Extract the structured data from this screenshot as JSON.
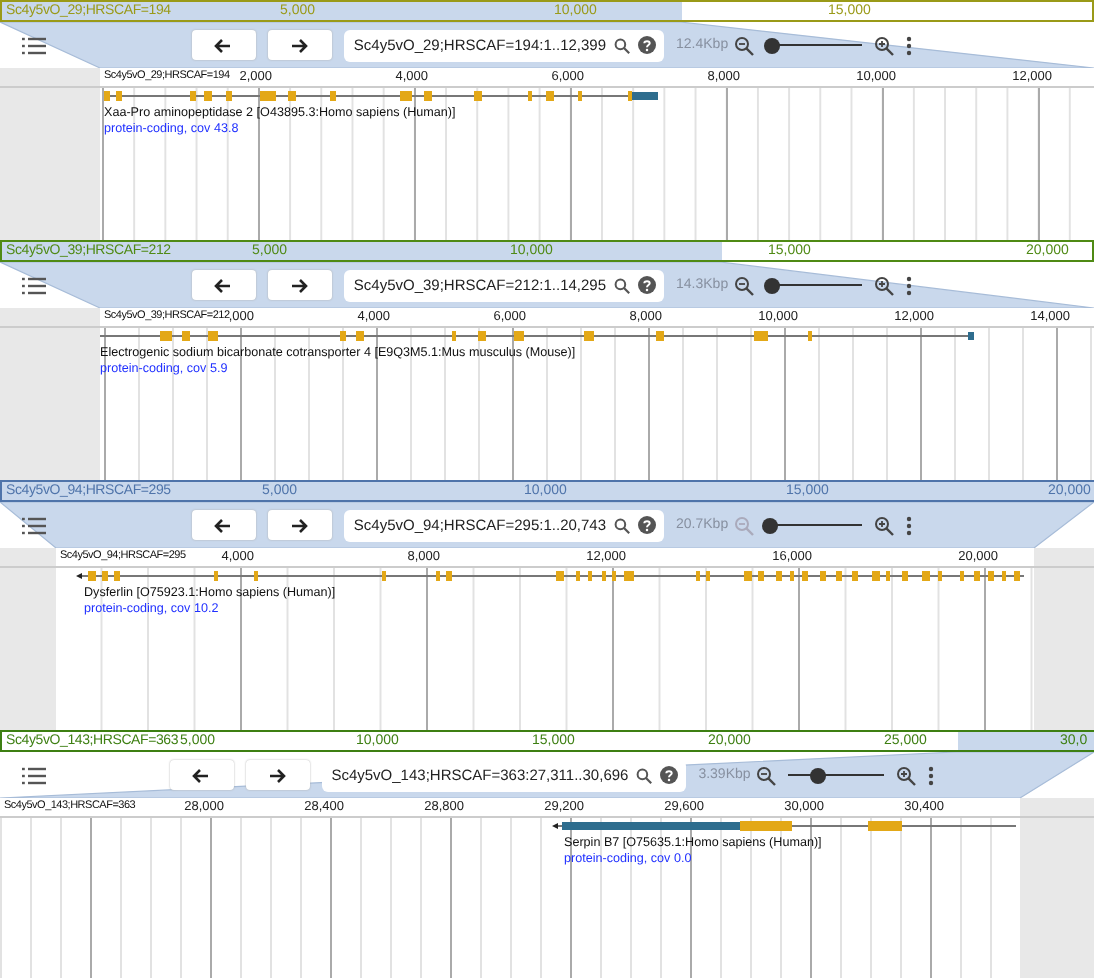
{
  "panels": [
    {
      "overview": {
        "scaffold": "Sc4y5vO_29;HRSCAF=194",
        "color": "#9a9a18",
        "ticks": [
          "5,000",
          "10,000",
          "15,000"
        ]
      },
      "toolbar": {
        "location": "Sc4y5vO_29;HRSCAF=194:1..12,399",
        "span": "12.4Kbp",
        "zoom_out_disabled": false,
        "zoom_slider": {
          "level": 0.05
        }
      },
      "ruler": {
        "scaffold": "Sc4y5vO_29;HRSCAF=194",
        "ticks": [
          "2,000",
          "4,000",
          "6,000",
          "8,000",
          "10,000",
          "12,000"
        ]
      },
      "feature": {
        "name": "Xaa-Pro aminopeptidase 2 [O43895.3:Homo sapiens (Human)]",
        "description": "protein-coding, cov 43.8"
      }
    },
    {
      "overview": {
        "scaffold": "Sc4y5vO_39;HRSCAF=212",
        "color": "#4f8a14",
        "ticks": [
          "5,000",
          "10,000",
          "15,000",
          "20,000"
        ]
      },
      "toolbar": {
        "location": "Sc4y5vO_39;HRSCAF=212:1..14,295",
        "span": "14.3Kbp",
        "zoom_out_disabled": false,
        "zoom_slider": {
          "level": 0.05
        }
      },
      "ruler": {
        "scaffold": "Sc4y5vO_39;HRSCAF=212",
        "ticks": [
          ",000",
          "4,000",
          "6,000",
          "8,000",
          "10,000",
          "12,000",
          "14,000"
        ]
      },
      "feature": {
        "name": "Electrogenic sodium bicarbonate cotransporter 4 [E9Q3M5.1:Mus musculus (Mouse)]",
        "description": "protein-coding, cov 5.9"
      }
    },
    {
      "overview": {
        "scaffold": "Sc4y5vO_94;HRSCAF=295",
        "color": "#4f74aa",
        "ticks": [
          "5,000",
          "10,000",
          "15,000",
          "20,000"
        ]
      },
      "toolbar": {
        "location": "Sc4y5vO_94;HRSCAF=295:1..20,743",
        "span": "20.7Kbp",
        "zoom_out_disabled": true,
        "zoom_slider": {
          "level": 0.03
        }
      },
      "ruler": {
        "scaffold": "Sc4y5vO_94;HRSCAF=295",
        "ticks": [
          "4,000",
          "8,000",
          "12,000",
          "16,000",
          "20,000"
        ]
      },
      "feature": {
        "name": "Dysferlin [O75923.1:Homo sapiens (Human)]",
        "description": "protein-coding, cov 10.2"
      }
    },
    {
      "overview": {
        "scaffold": "Sc4y5vO_143;HRSCAF=363",
        "color": "#3d7f12",
        "ticks": [
          "5,000",
          "10,000",
          "15,000",
          "20,000",
          "25,000",
          "30,0"
        ]
      },
      "toolbar": {
        "location": "Sc4y5vO_143;HRSCAF=363:27,311..30,696",
        "span": "3.39Kbp",
        "zoom_out_disabled": false,
        "zoom_slider": {
          "level": 0.3
        }
      },
      "ruler": {
        "scaffold": "Sc4y5vO_143;HRSCAF=363",
        "ticks": [
          "28,000",
          "28,400",
          "28,800",
          "29,200",
          "29,600",
          "30,000",
          "30,400"
        ]
      },
      "feature": {
        "name": "Serpin B7 [O75635.1:Homo sapiens (Human)]",
        "description": "protein-coding, cov 0.0"
      }
    }
  ]
}
